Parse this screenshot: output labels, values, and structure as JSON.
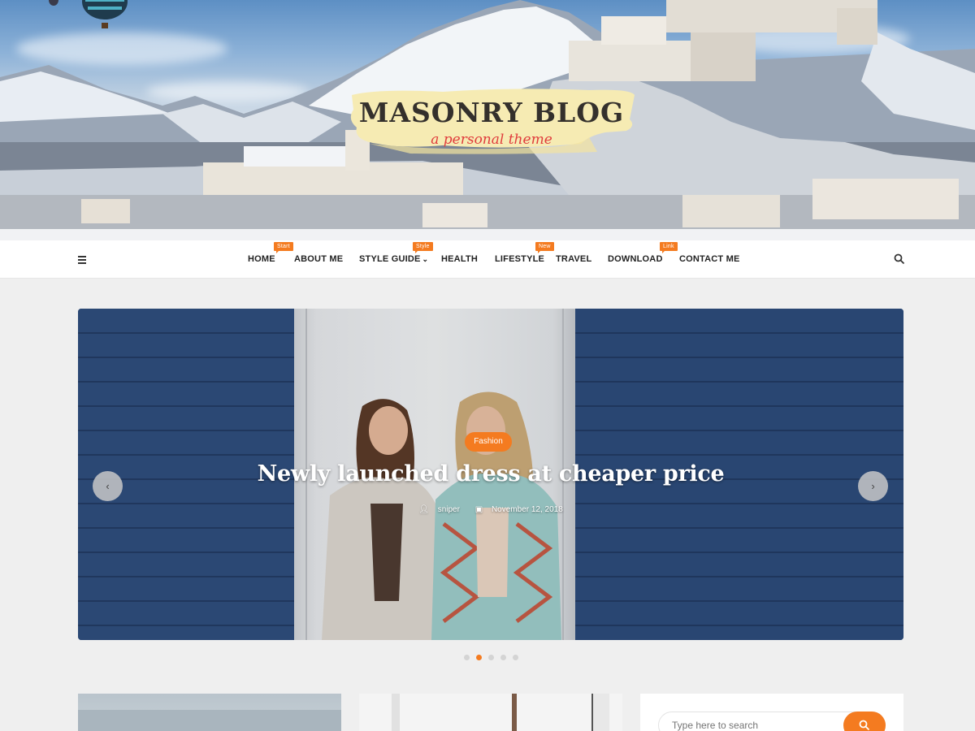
{
  "site": {
    "title": "MASONRY BLOG",
    "tagline": "a personal theme"
  },
  "nav": {
    "items": [
      {
        "label": "HOME",
        "badge": "Start"
      },
      {
        "label": "ABOUT ME",
        "badge": ""
      },
      {
        "label": "STYLE GUIDE",
        "badge": "Style",
        "dropdown": true
      },
      {
        "label": "HEALTH",
        "badge": ""
      },
      {
        "label": "LIFESTYLE",
        "badge": "New"
      },
      {
        "label": "TRAVEL",
        "badge": ""
      },
      {
        "label": "DOWNLOAD",
        "badge": "Link"
      },
      {
        "label": "CONTACT ME",
        "badge": ""
      }
    ],
    "menu_icon": "hamburger-icon",
    "search_icon": "search-icon"
  },
  "slider": {
    "category": "Fashion",
    "title": "Newly launched dress at cheaper price",
    "author": "sniper",
    "date": "November 12, 2018",
    "prev_icon": "chevron-left-icon",
    "next_icon": "chevron-right-icon",
    "slide_count": 5,
    "active_slide": 2
  },
  "sidebar": {
    "search_placeholder": "Type here to search"
  },
  "colors": {
    "accent": "#f47b20",
    "nav_bg": "#ffffff",
    "page_bg": "#efefef"
  }
}
